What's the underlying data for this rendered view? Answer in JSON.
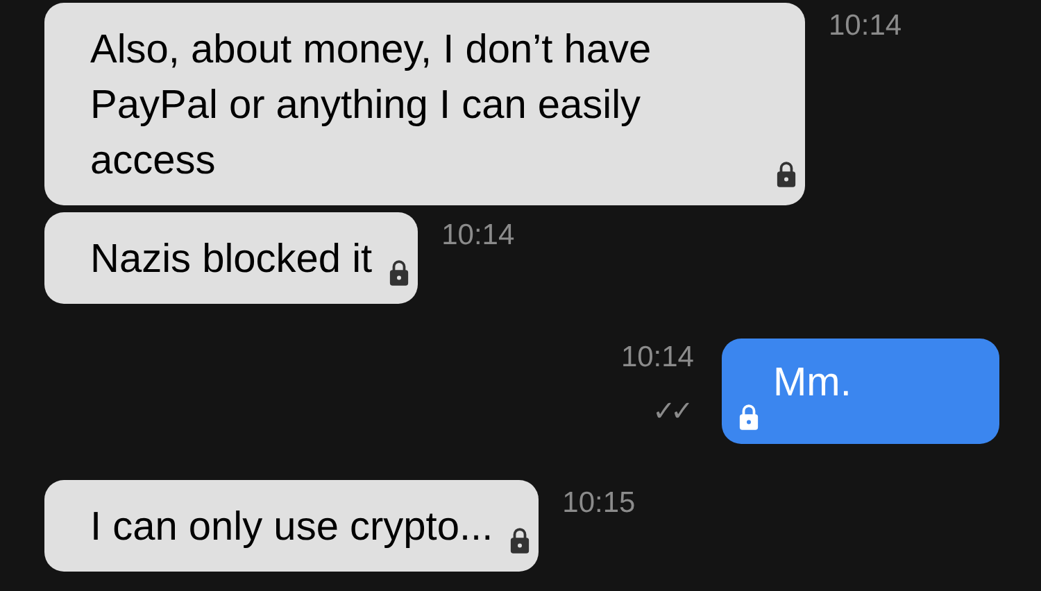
{
  "messages": [
    {
      "kind": "incoming",
      "text": "Also, about money, I don’t have PayPal or anything I can easily access",
      "time": "10:14",
      "encrypted": true
    },
    {
      "kind": "incoming",
      "text": "Nazis blocked it",
      "time": "10:14",
      "encrypted": true
    },
    {
      "kind": "outgoing",
      "text": "Mm.",
      "time": "10:14",
      "encrypted": true,
      "receipt": "✓✓"
    },
    {
      "kind": "incoming",
      "text": "I can only use crypto...",
      "time": "10:15",
      "encrypted": true
    }
  ]
}
